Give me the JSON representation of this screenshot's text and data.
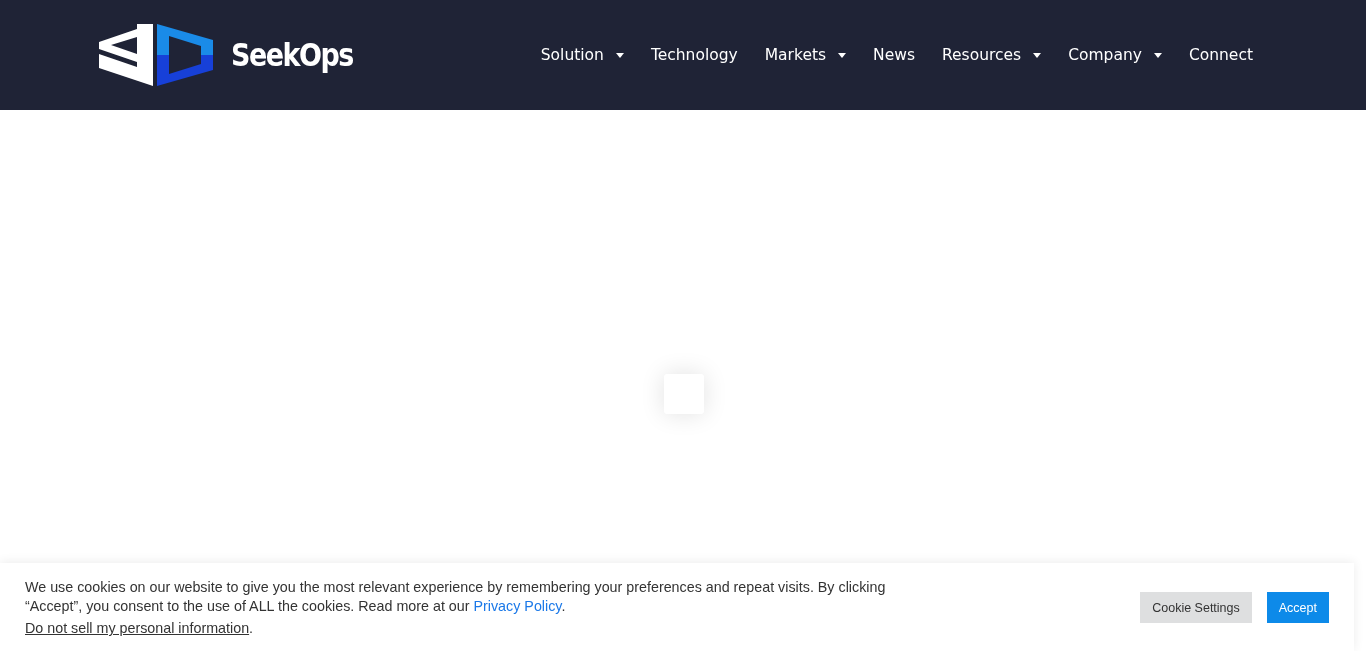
{
  "header": {
    "logo_text": "SeekOps",
    "nav": [
      {
        "label": "Solution",
        "dropdown": true
      },
      {
        "label": "Technology",
        "dropdown": false
      },
      {
        "label": "Markets",
        "dropdown": true
      },
      {
        "label": "News",
        "dropdown": false
      },
      {
        "label": "Resources",
        "dropdown": true
      },
      {
        "label": "Company",
        "dropdown": true
      },
      {
        "label": "Connect",
        "dropdown": false
      }
    ]
  },
  "loader": {
    "kind": "spinner-box"
  },
  "cookie_bar": {
    "message": "We use cookies on our website to give you the most relevant experience by remembering your preferences and repeat visits. By clicking “Accept”, you consent to the use of ALL the cookies. Read more at our ",
    "policy_link": "Privacy Policy",
    "message_end": ".",
    "opt_out_link": "Do not sell my personal information",
    "opt_out_end": ".",
    "buttons": [
      "Cookie Settings",
      "Accept"
    ]
  }
}
